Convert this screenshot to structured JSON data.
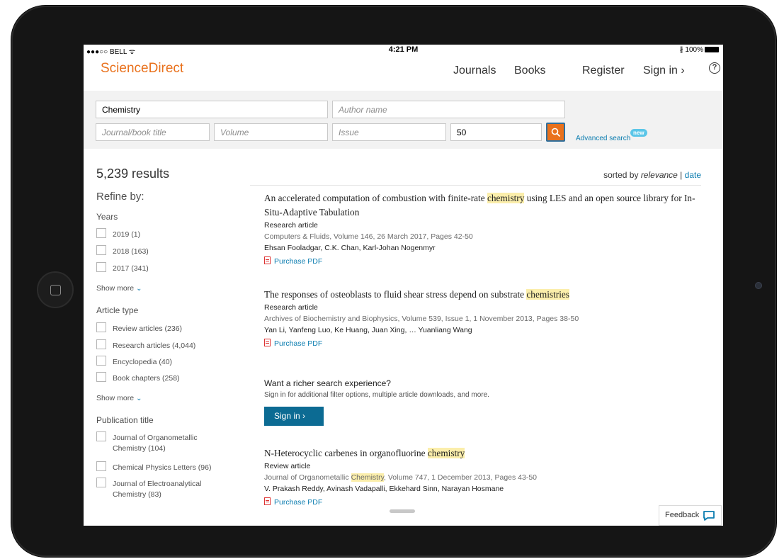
{
  "statusbar": {
    "carrier": "●●●○○ BELL ᯤ",
    "time": "4:21 PM",
    "battery": "∦ 100%"
  },
  "header": {
    "brand": "ScienceDirect",
    "nav": {
      "journals": "Journals",
      "books": "Books",
      "register": "Register",
      "signin": "Sign in ›"
    },
    "help": "?"
  },
  "search": {
    "keywords": "Chemistry",
    "author_placeholder": "Author name",
    "journal_placeholder": "Journal/book title",
    "volume_placeholder": "Volume",
    "issue_placeholder": "Issue",
    "pages": "50",
    "advanced": "Advanced search",
    "new_badge": "new"
  },
  "sidebar": {
    "results_count": "5,239 results",
    "refine": "Refine by:",
    "years_title": "Years",
    "years": [
      "2019 (1)",
      "2018 (163)",
      "2017 (341)"
    ],
    "show_more": "Show more",
    "article_type_title": "Article type",
    "article_types": [
      "Review articles (236)",
      "Research articles (4,044)",
      "Encyclopedia (40)",
      "Book chapters (258)"
    ],
    "publication_title": "Publication title",
    "publications": [
      {
        "l1": "Journal of Organometallic",
        "l2": "Chemistry (104)"
      },
      {
        "l1": "Chemical Physics Letters (96)"
      },
      {
        "l1": "Journal of Electroanalytical",
        "l2": "Chemistry (83)"
      }
    ]
  },
  "sort": {
    "prefix": "sorted by ",
    "relevance": "relevance",
    "sep": " | ",
    "date": "date"
  },
  "results": [
    {
      "title_before": "An accelerated computation of combustion with finite-rate ",
      "title_hl": "chemistry",
      "title_after": " using LES and an open source library for In-Situ-Adaptive Tabulation",
      "type": "Research article",
      "source": "Computers & Fluids, Volume 146, 26 March 2017, Pages 42-50",
      "authors": "Ehsan Fooladgar, C.K. Chan, Karl-Johan Nogenmyr",
      "pdf": "Purchase PDF"
    },
    {
      "title_before": "The responses of osteoblasts to fluid shear stress depend on substrate ",
      "title_hl": "chemistries",
      "title_after": "",
      "type": "Research article",
      "source": "Archives of Biochemistry and Biophysics, Volume 539, Issue 1, 1 November 2013, Pages 38-50",
      "authors": "Yan Li, Yanfeng Luo, Ke Huang, Juan Xing, … Yuanliang Wang",
      "pdf": "Purchase PDF"
    },
    {
      "title_before": "N-Heterocyclic carbenes in organofluorine ",
      "title_hl": "chemistry",
      "title_after": "",
      "type": "Review article",
      "source_before": "Journal of Organometallic ",
      "source_hl": "Chemistry",
      "source_after": ", Volume 747, 1 December 2013, Pages 43-50",
      "authors": "V. Prakash Reddy, Avinash Vadapalli, Ekkehard Sinn, Narayan Hosmane",
      "pdf": "Purchase PDF"
    }
  ],
  "promo": {
    "heading": "Want a richer search experience?",
    "sub": "Sign in for additional filter options, multiple article downloads, and more.",
    "button": "Sign in ›"
  },
  "feedback": "Feedback",
  "colors": {
    "brand": "#e9711c",
    "link": "#0c7db0",
    "button": "#0c6b93",
    "highlight": "#fbeeab"
  }
}
